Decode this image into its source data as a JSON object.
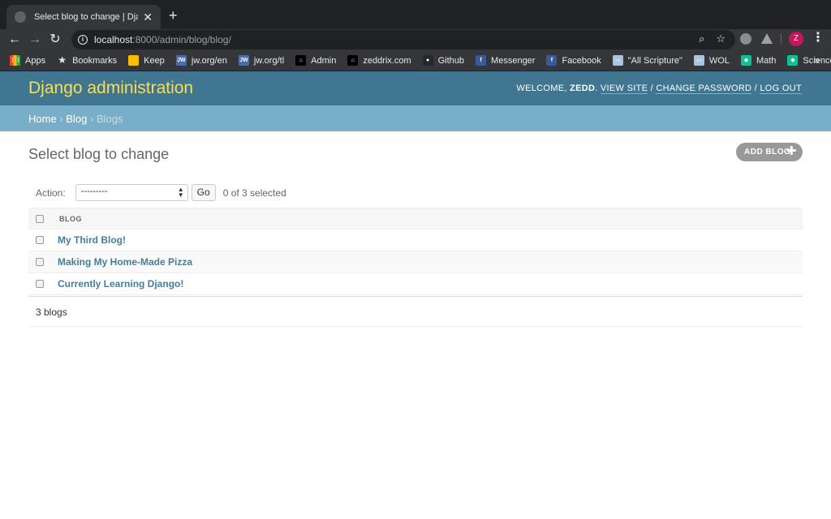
{
  "browser": {
    "tab_title": "Select blog to change | Django s",
    "tab_close": "✕",
    "new_tab": "+",
    "url_host": "localhost",
    "url_rest": ":8000/admin/blog/blog/",
    "avatar_letter": "Z",
    "bookmarks": [
      {
        "label": "Apps",
        "icon": "apps-grid-icon",
        "color": "#e8453c"
      },
      {
        "label": "Bookmarks",
        "icon": "star-icon",
        "color": "#e8eaed"
      },
      {
        "label": "Keep",
        "icon": "keep-bulb-icon",
        "color": "#fbbc04"
      },
      {
        "label": "jw.org/en",
        "icon": "jw-icon",
        "color": "#4a6da7"
      },
      {
        "label": "jw.org/tl",
        "icon": "jw-icon",
        "color": "#4a6da7"
      },
      {
        "label": "Admin",
        "icon": "admin-icon",
        "color": "#000000"
      },
      {
        "label": "zeddrix.com",
        "icon": "zeddrix-icon",
        "color": "#000000"
      },
      {
        "label": "Github",
        "icon": "github-icon",
        "color": "#24292e"
      },
      {
        "label": "Messenger",
        "icon": "facebook-icon",
        "color": "#3b5998"
      },
      {
        "label": "Facebook",
        "icon": "facebook-icon",
        "color": "#3b5998"
      },
      {
        "label": "\"All Scripture\"",
        "icon": "book-icon",
        "color": "#a8c4e0"
      },
      {
        "label": "WOL",
        "icon": "book-icon",
        "color": "#a8c4e0"
      },
      {
        "label": "Math",
        "icon": "khan-icon",
        "color": "#14bf96"
      },
      {
        "label": "Science",
        "icon": "khan-icon",
        "color": "#14bf96"
      }
    ],
    "more": "»"
  },
  "admin": {
    "site_title": "Django administration",
    "welcome": "WELCOME,",
    "username": "ZEDD",
    "view_site": "VIEW SITE",
    "change_password": "CHANGE PASSWORD",
    "log_out": "LOG OUT",
    "crumb_home": "Home",
    "crumb_blog": "Blog",
    "crumb_current": "Blogs",
    "separator": "›",
    "slash": "/",
    "page_title": "Select blog to change",
    "add_button": "ADD BLOG",
    "action_label": "Action:",
    "action_selected": "---------",
    "go_button": "Go",
    "selection_counter": "0 of 3 selected",
    "column_header": "Blog",
    "rows": [
      "My Third Blog!",
      "Making My Home-Made Pizza",
      "Currently Learning Django!"
    ],
    "result_count": "3 blogs"
  },
  "colors": {
    "header": "#417690",
    "branding": "#f5dd5d",
    "breadcrumbs": "#79aec8",
    "link": "#447e9b"
  }
}
